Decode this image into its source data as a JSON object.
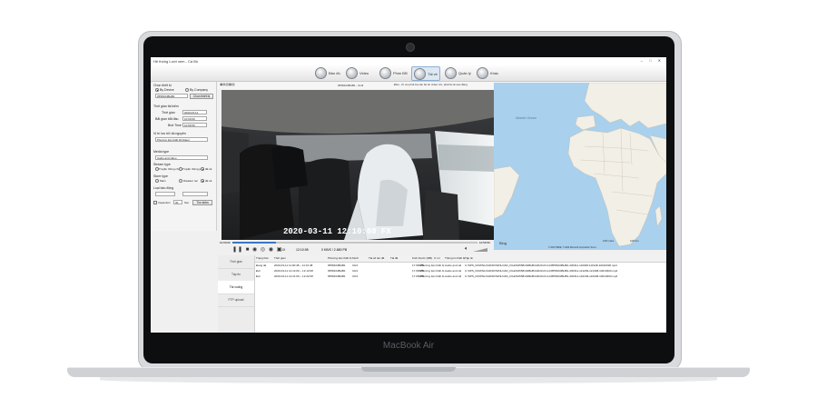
{
  "device": {
    "brand": "MacBook Air"
  },
  "window": {
    "title": "Hệ thống Lưới xem - Cá Bồ",
    "controls": "–  □  ✕"
  },
  "toolbar": {
    "items": [
      {
        "label": "Bản đồ",
        "icon": "map-icon"
      },
      {
        "label": "Video",
        "icon": "video-icon"
      },
      {
        "label": "Phim ĐB",
        "icon": "film-icon"
      },
      {
        "label": "Tải về",
        "icon": "download-icon"
      },
      {
        "label": "Quản lý",
        "icon": "manage-icon"
      },
      {
        "label": "Khác",
        "icon": "more-icon"
      }
    ]
  },
  "left_panel": {
    "section_title": "Chọn thiết bị",
    "by_device": "By Device",
    "by_company": "By Company",
    "device_value": "0558104BHB1",
    "select_button": "Chọn thiết bị",
    "time_title": "Thời gian tài kiếm",
    "date_label": "Thời gian",
    "date_value": "2020-03-11",
    "start_label": "Bắt gian bắt đầu",
    "start_value": "10:00:00",
    "end_label": "Bnd Time",
    "end_value": "10:59:59",
    "location_label": "Vị trí lưu trữ tài nguyên",
    "location_value": "Phương tiện thiết bị(Video)",
    "media_type_label": "Media type",
    "media_type_value": "Audio and video",
    "stream_type_label": "Stream type",
    "stream_opt1": "Truyền thông chính",
    "stream_opt2": "Truyền thông phụ",
    "stream_opt3": "tất cả",
    "store_type_label": "Store type",
    "store_opt1": "Main",
    "store_opt2": "Disaster rec",
    "store_opt3": "tất cả",
    "alarm_label": "Loại báo động",
    "inspection_label": "Inspection",
    "inspection_value": "30",
    "inspection_unit": "Sec",
    "search_button": "Tìm kiếm"
  },
  "video": {
    "header_left": "0558104BHB1 - CH3",
    "osd_text": "2020-03-11  12:10:08  FX"
  },
  "map": {
    "header": "Đầu - Ủi vui phút ba các bộ tin video tìm, phải là về sao động",
    "ocean_label": "Atlantic Ocean",
    "scale_1": "1000 miles",
    "scale_2": "1000 km",
    "copyright": "© 2020 HERE, © 2020 Microsoft Corporation  Terms",
    "bing": "Bing"
  },
  "playback": {
    "time_start": "10:00:00",
    "time_end": "10:59:59",
    "speed": "1X",
    "elapsed": "12:10:08",
    "bitrate": "0 KB/S / 2.680 PB"
  },
  "bottom_nav": [
    {
      "label": "Thời gian"
    },
    {
      "label": "Tập tin"
    },
    {
      "label": "Tải xuống"
    },
    {
      "label": "FTP upload"
    }
  ],
  "table": {
    "columns": [
      "Trạng thái",
      "Thời gian",
      "Phương tiện thiết bị",
      "Kênh",
      "Tài số tên đề",
      "Tài đề",
      "Kích thước (MB)",
      "Ư mi",
      "Thông tin thiết bị",
      "Tập tin"
    ],
    "rows": [
      [
        "Đang tải",
        "2020-03-11  11:00:48 ~ 11:01:48",
        "0558104BHB1",
        "CH3",
        "",
        "",
        "17.9MMB",
        "Phương tiện thiết bị",
        "Audio and vid",
        "C:\\SPS_DOWNLOAD\\DOWNLOAD_FILES\\0558104BHB1\\2020-03-11\\0558104BHB1-200311-110048-110148-10010300.mp4"
      ],
      [
        "Đợi",
        "2020-03-11  12:12:09 ~ 12:13:08",
        "0558104BHB1",
        "CH3",
        "",
        "",
        "17.9MMB",
        "Phương tiện thiết bị",
        "Audio and vid",
        "C:\\SPS_DOWNLOAD\\DOWNLOAD_FILES\\0558104BHB1\\2020-03-11\\0558104BHB1-200311-121209-121308-10010300.mp4"
      ],
      [
        "Đợi",
        "2020-03-11  12:21:09 ~ 12:22:08",
        "0558104BHB1",
        "CH3",
        "",
        "",
        "17.9MMB",
        "Phương tiện thiết bị",
        "Audio and vid",
        "C:\\SPS_DOWNLOAD\\DOWNLOAD_FILES\\0558104BHB1\\2020-03-11\\0558104BHB1-200311-122109-122208-10010300.mp4"
      ]
    ]
  }
}
